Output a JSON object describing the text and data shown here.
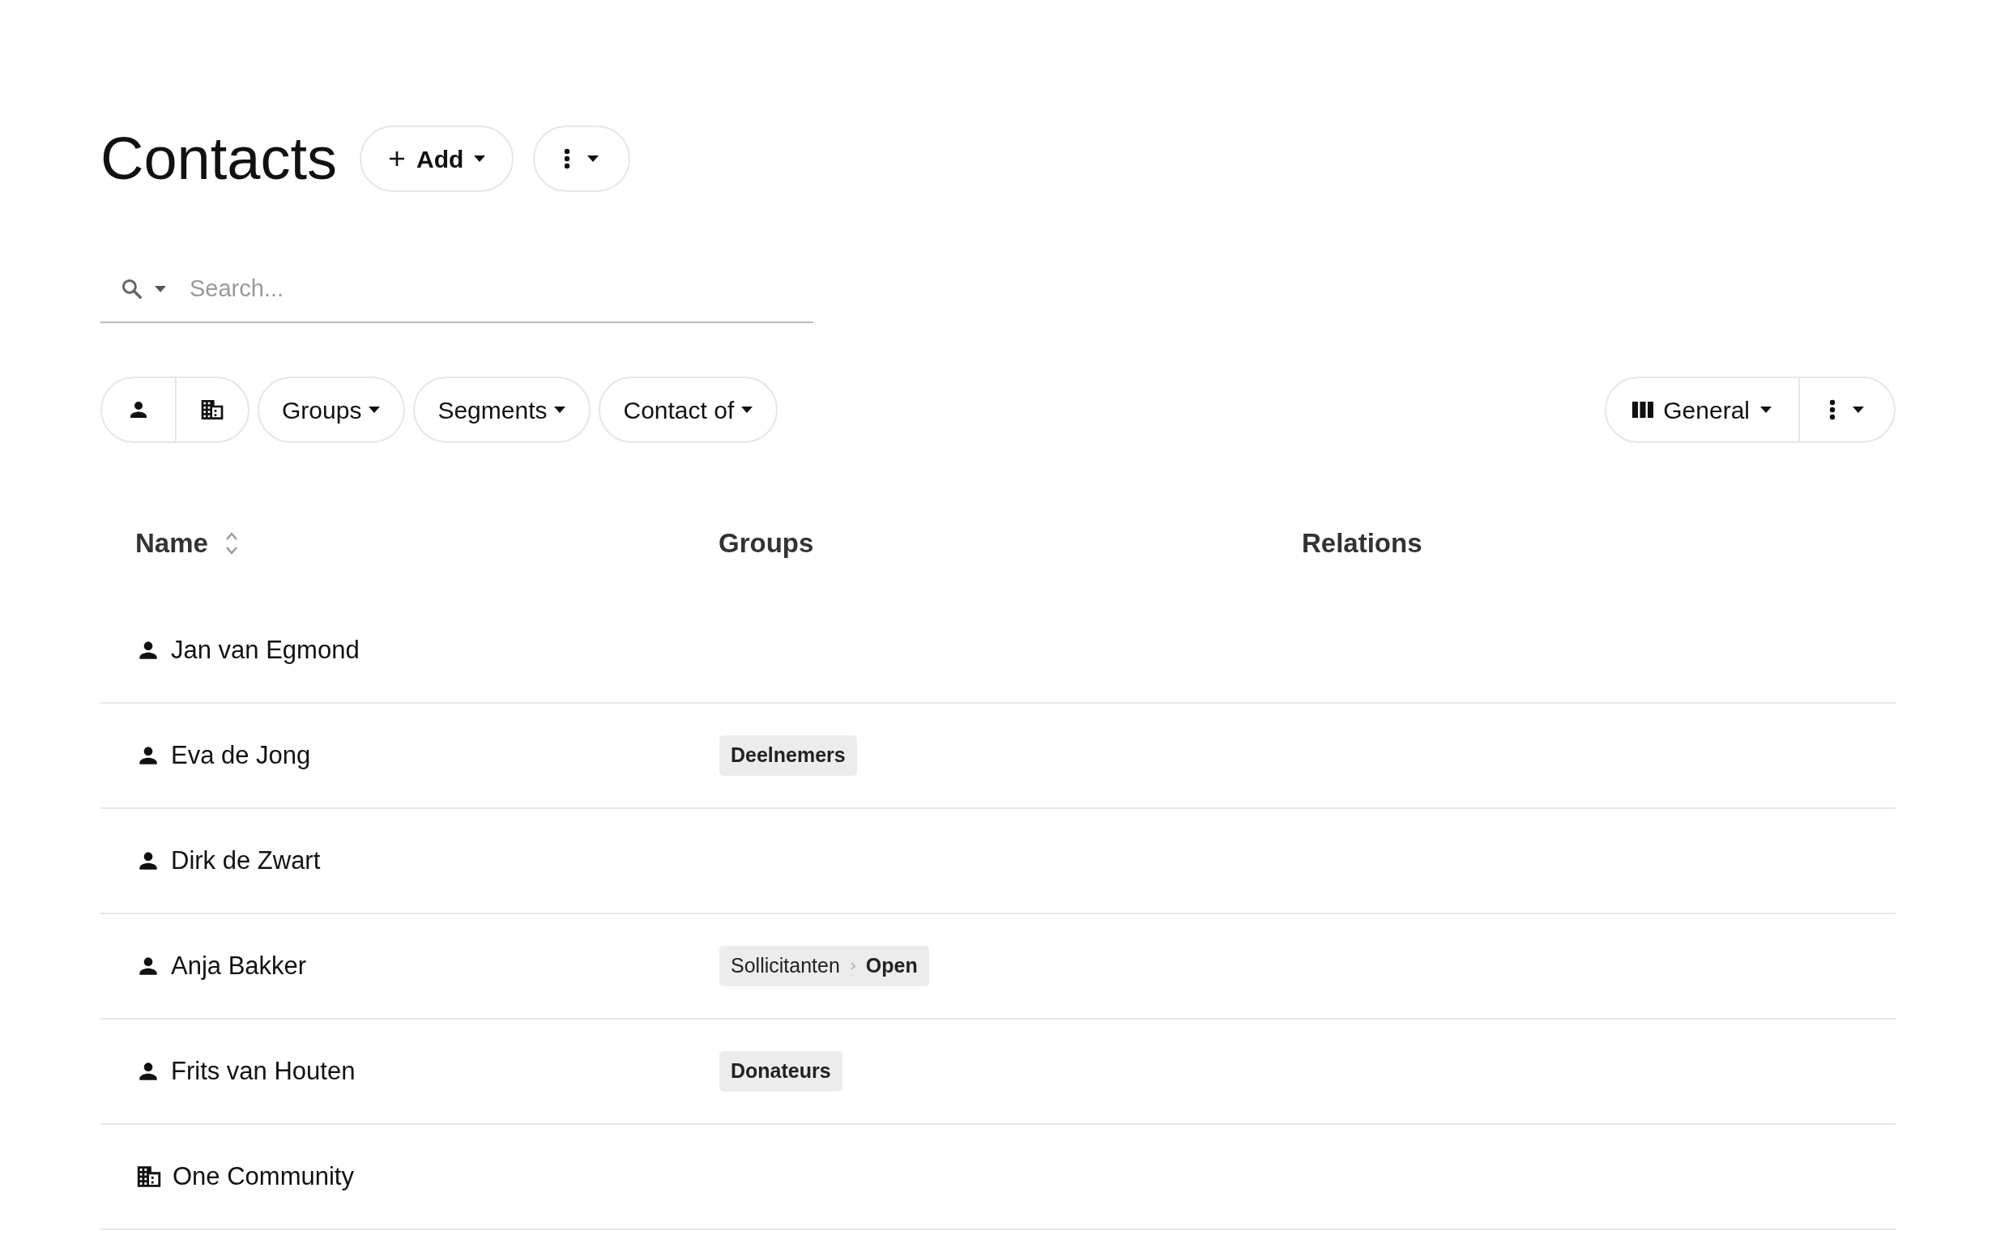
{
  "page": {
    "title": "Contacts"
  },
  "header_buttons": [
    {
      "kind": "add",
      "label": "Add"
    },
    {
      "kind": "more"
    }
  ],
  "search": {
    "placeholder": "Search..."
  },
  "filters": [
    {
      "kind": "person"
    },
    {
      "kind": "organization"
    },
    {
      "kind": "dropdown",
      "label": "Groups"
    },
    {
      "kind": "dropdown",
      "label": "Segments"
    },
    {
      "kind": "dropdown",
      "label": "Contact of"
    }
  ],
  "view_controls": [
    {
      "kind": "columns",
      "label": "General"
    },
    {
      "kind": "more"
    }
  ],
  "table": {
    "columns": [
      {
        "label": "Name",
        "sortable": true
      },
      {
        "label": "Groups",
        "sortable": false
      },
      {
        "label": "Relations",
        "sortable": false
      }
    ],
    "rows": [
      {
        "kind": "person",
        "name": "Jan van Egmond",
        "groups": []
      },
      {
        "kind": "person",
        "name": "Eva de Jong",
        "groups": [
          {
            "name": "Deelnemers"
          }
        ]
      },
      {
        "kind": "person",
        "name": "Dirk de Zwart",
        "groups": []
      },
      {
        "kind": "person",
        "name": "Anja Bakker",
        "groups": [
          {
            "parent": "Sollicitanten",
            "name": "Open"
          }
        ]
      },
      {
        "kind": "person",
        "name": "Frits van Houten",
        "groups": [
          {
            "name": "Donateurs"
          }
        ]
      },
      {
        "kind": "organization",
        "name": "One Community",
        "groups": []
      }
    ]
  }
}
